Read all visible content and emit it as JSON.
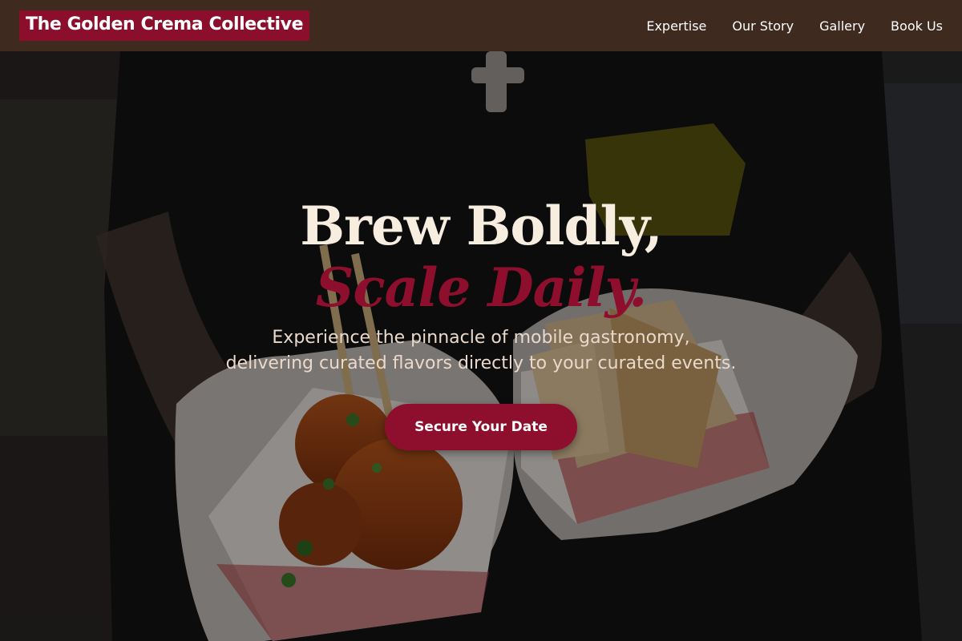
{
  "header": {
    "brand": "The Golden Crema Collective",
    "nav": [
      {
        "label": "Expertise"
      },
      {
        "label": "Our Story"
      },
      {
        "label": "Gallery"
      },
      {
        "label": "Book Us"
      }
    ]
  },
  "hero": {
    "headline_line1": "Brew Boldly,",
    "headline_line2": "Scale Daily.",
    "subtext_line1": "Experience the pinnacle of mobile gastronomy,",
    "subtext_line2": "delivering curated flavors directly to your curated events.",
    "cta_label": "Secure Your Date",
    "background_image": "chef-gloved-hands-holding-meatballs-and-samosas"
  },
  "colors": {
    "nav_bg": "#3f2a1f",
    "accent": "#8e0f2d",
    "headline": "#f7eee0"
  }
}
